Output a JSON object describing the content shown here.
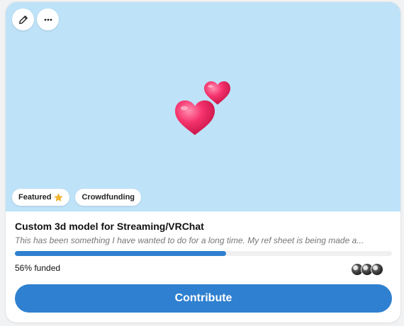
{
  "card": {
    "banner_color": "#bee2f8",
    "toolbar": {
      "edit_icon": "pencil-icon",
      "more_icon": "ellipsis-icon"
    },
    "banner_image": "two-hearts",
    "tags": [
      {
        "label": "Featured",
        "icon": "star-icon"
      },
      {
        "label": "Crowdfunding"
      }
    ],
    "title": "Custom 3d model for Streaming/VRChat",
    "description": "This has been something I have wanted to do for a long time. My ref sheet is being made a...",
    "progress": {
      "percent": 56,
      "label": "56% funded"
    },
    "contributors": {
      "count_shown": 3
    },
    "contribute_label": "Contribute",
    "accent_color": "#2f80d0"
  }
}
